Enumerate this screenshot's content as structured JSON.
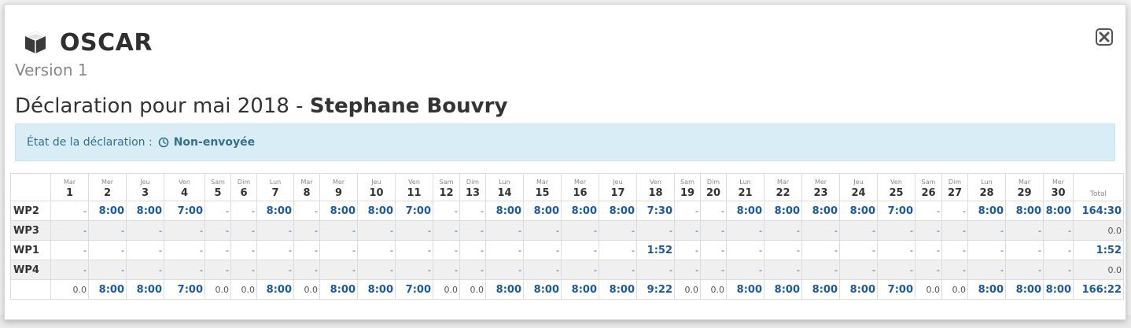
{
  "modal": {
    "title": "OSCAR",
    "version": "Version 1",
    "declaration_prefix": "Déclaration pour mai 2018 - ",
    "declaration_person": "Stephane Bouvry",
    "status_label": "État de la déclaration :",
    "status_value": "Non-envoyée",
    "close_icon": "close-icon",
    "header_icon": "cube-icon",
    "status_icon": "clock-icon"
  },
  "table": {
    "total_header": "Total",
    "days": [
      {
        "d": "Mar",
        "n": "1"
      },
      {
        "d": "Mer",
        "n": "2"
      },
      {
        "d": "Jeu",
        "n": "3"
      },
      {
        "d": "Ven",
        "n": "4"
      },
      {
        "d": "Sam",
        "n": "5"
      },
      {
        "d": "Dim",
        "n": "6"
      },
      {
        "d": "Lun",
        "n": "7"
      },
      {
        "d": "Mar",
        "n": "8"
      },
      {
        "d": "Mer",
        "n": "9"
      },
      {
        "d": "Jeu",
        "n": "10"
      },
      {
        "d": "Ven",
        "n": "11"
      },
      {
        "d": "Sam",
        "n": "12"
      },
      {
        "d": "Dim",
        "n": "13"
      },
      {
        "d": "Lun",
        "n": "14"
      },
      {
        "d": "Mar",
        "n": "15"
      },
      {
        "d": "Mer",
        "n": "16"
      },
      {
        "d": "Jeu",
        "n": "17"
      },
      {
        "d": "Ven",
        "n": "18"
      },
      {
        "d": "Sam",
        "n": "19"
      },
      {
        "d": "Dim",
        "n": "20"
      },
      {
        "d": "Lun",
        "n": "21"
      },
      {
        "d": "Mar",
        "n": "22"
      },
      {
        "d": "Mer",
        "n": "23"
      },
      {
        "d": "Jeu",
        "n": "24"
      },
      {
        "d": "Ven",
        "n": "25"
      },
      {
        "d": "Sam",
        "n": "26"
      },
      {
        "d": "Dim",
        "n": "27"
      },
      {
        "d": "Lun",
        "n": "28"
      },
      {
        "d": "Mar",
        "n": "29"
      },
      {
        "d": "Mer",
        "n": "30"
      }
    ],
    "rows": [
      {
        "label": "WP2",
        "values": [
          "-",
          "8:00",
          "8:00",
          "7:00",
          "-",
          "-",
          "8:00",
          "-",
          "8:00",
          "8:00",
          "7:00",
          "-",
          "-",
          "8:00",
          "8:00",
          "8:00",
          "8:00",
          "7:30",
          "-",
          "-",
          "8:00",
          "8:00",
          "8:00",
          "8:00",
          "7:00",
          "-",
          "-",
          "8:00",
          "8:00",
          "8:00"
        ],
        "total": "164:30"
      },
      {
        "label": "WP3",
        "values": [
          "-",
          "-",
          "-",
          "-",
          "-",
          "-",
          "-",
          "-",
          "-",
          "-",
          "-",
          "-",
          "-",
          "-",
          "-",
          "-",
          "-",
          "-",
          "-",
          "-",
          "-",
          "-",
          "-",
          "-",
          "-",
          "-",
          "-",
          "-",
          "-",
          "-"
        ],
        "total": "0.0"
      },
      {
        "label": "WP1",
        "values": [
          "-",
          "-",
          "-",
          "-",
          "-",
          "-",
          "-",
          "-",
          "-",
          "-",
          "-",
          "-",
          "-",
          "-",
          "-",
          "-",
          "-",
          "1:52",
          "-",
          "-",
          "-",
          "-",
          "-",
          "-",
          "-",
          "-",
          "-",
          "-",
          "-",
          "-"
        ],
        "total": "1:52"
      },
      {
        "label": "WP4",
        "values": [
          "-",
          "-",
          "-",
          "-",
          "-",
          "-",
          "-",
          "-",
          "-",
          "-",
          "-",
          "-",
          "-",
          "-",
          "-",
          "-",
          "-",
          "-",
          "-",
          "-",
          "-",
          "-",
          "-",
          "-",
          "-",
          "-",
          "-",
          "-",
          "-",
          "-"
        ],
        "total": "0.0"
      }
    ],
    "totals": {
      "label": "",
      "values": [
        "0.0",
        "8:00",
        "8:00",
        "7:00",
        "0.0",
        "0.0",
        "8:00",
        "0.0",
        "8:00",
        "8:00",
        "7:00",
        "0.0",
        "0.0",
        "8:00",
        "8:00",
        "8:00",
        "8:00",
        "9:22",
        "0.0",
        "0.0",
        "8:00",
        "8:00",
        "8:00",
        "8:00",
        "7:00",
        "0.0",
        "0.0",
        "8:00",
        "8:00",
        "8:00"
      ],
      "total": "166:22"
    }
  }
}
